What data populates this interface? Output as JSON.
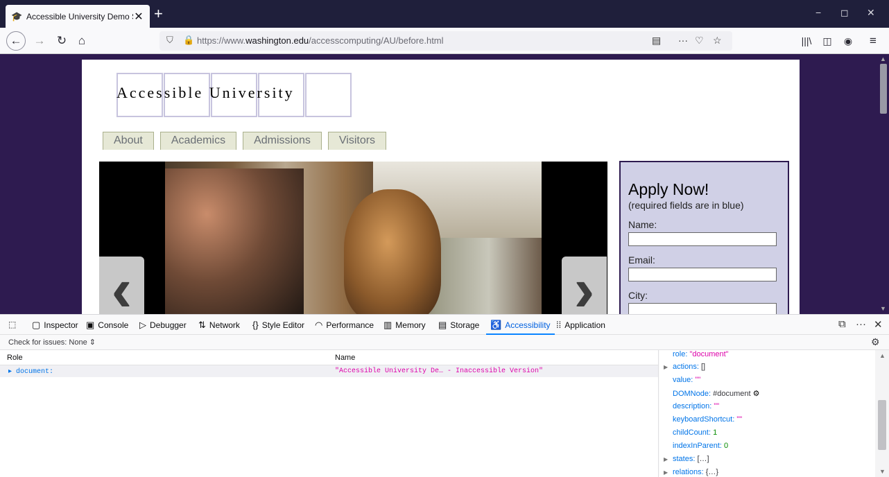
{
  "browser": {
    "tab": {
      "title": "Accessible University Demo Site",
      "favicon": "mortarboard-icon",
      "close": "✕"
    },
    "new_tab": "+",
    "window_controls": [
      "−",
      "◻",
      "✕"
    ],
    "url_prefix": "https://www.",
    "url_domain": "washington.edu",
    "url_path": "/accesscomputing/AU/before.html"
  },
  "site": {
    "logo_text": "Accessible University",
    "nav": [
      "About",
      "Academics",
      "Admissions",
      "Visitors"
    ],
    "carousel": {
      "prev": "‹",
      "next": "›"
    },
    "apply": {
      "heading": "Apply Now!",
      "subheading": "(required fields are in blue)",
      "fields": [
        "Name:",
        "Email:",
        "City:"
      ]
    }
  },
  "devtools": {
    "tabs": [
      "Inspector",
      "Console",
      "Debugger",
      "Network",
      "Style Editor",
      "Performance",
      "Memory",
      "Storage",
      "Accessibility",
      "Application"
    ],
    "active_tab": "Accessibility",
    "check_issues": "Check for issues:  None ⇕",
    "columns": {
      "role": "Role",
      "name": "Name"
    },
    "tree_row": {
      "role": "▸ document:",
      "name": "\"Accessible University De… - Inaccessible Version\""
    },
    "properties": {
      "role": {
        "key": "role:",
        "value": "\"document\""
      },
      "actions": {
        "key": "actions:",
        "value": "[]"
      },
      "value": {
        "key": "value:",
        "value": "\"\""
      },
      "dom_node": {
        "key": "DOMNode:",
        "value": "#document"
      },
      "description": {
        "key": "description:",
        "value": "\"\""
      },
      "keyboard_shortcut": {
        "key": "keyboardShortcut:",
        "value": "\"\""
      },
      "child_count": {
        "key": "childCount:",
        "value": "1"
      },
      "index_in_parent": {
        "key": "indexInParent:",
        "value": "0"
      },
      "states": {
        "key": "states:",
        "value": "[…]"
      },
      "relations": {
        "key": "relations:",
        "value": "{…}"
      }
    }
  }
}
